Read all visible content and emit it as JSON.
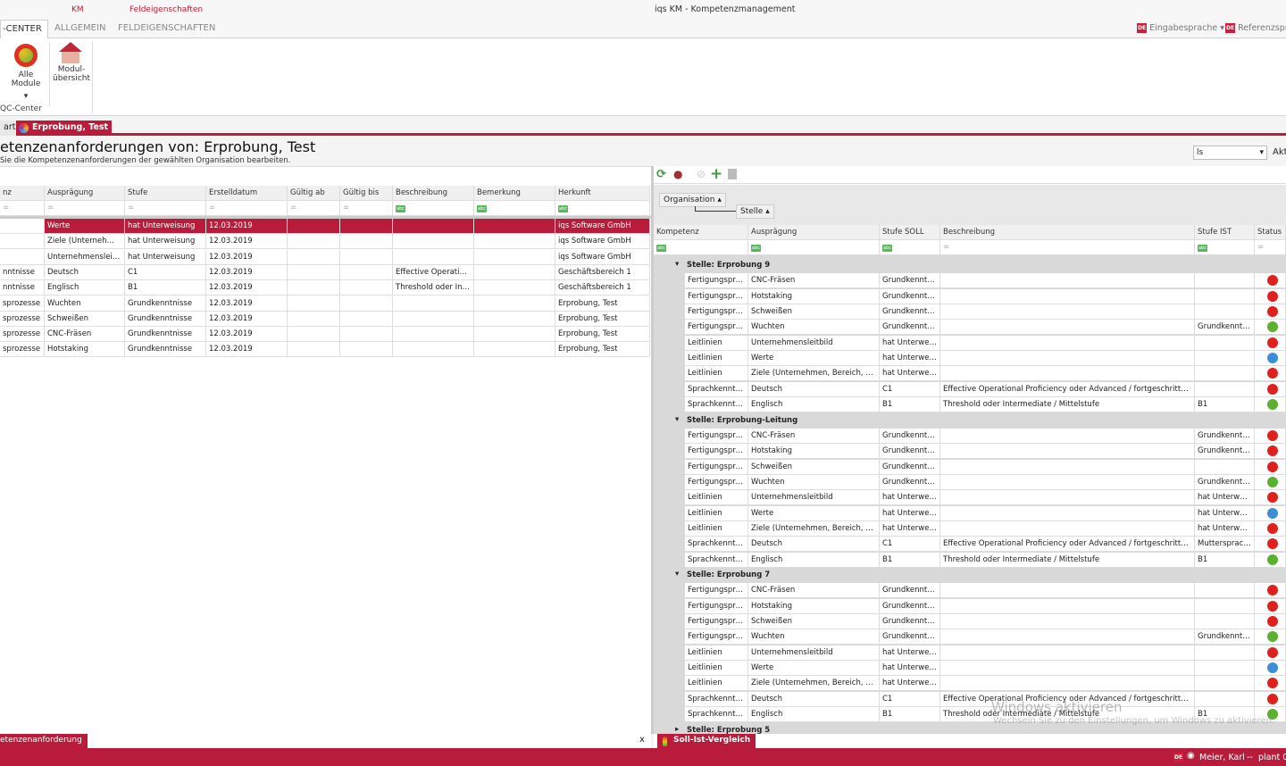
{
  "app": {
    "title": "iqs KM -  Kompetenzmanagement",
    "context_tabs": [
      "KM",
      "Feldeigenschaften"
    ]
  },
  "ribbon": {
    "tabs": [
      "-CENTER",
      "ALLGEMEIN",
      "FELDEIGENSCHAFTEN"
    ],
    "buttons": [
      "Alle Module",
      "Modul-übersicht"
    ],
    "group_label": "QC-Center",
    "lang_input": "Eingabesprache",
    "lang_ref": "Referenzspra",
    "lang_badge": "DE"
  },
  "doc_tabs": [
    "art",
    "Erprobung, Test"
  ],
  "page": {
    "title": "etenzenanforderungen von: Erprobung, Test",
    "subtitle": "Sie die Kompetenzenanforderungen der gewählten Organisation bearbeiten.",
    "combo_value": "ls",
    "combo_label": "Akt"
  },
  "left_table": {
    "columns": [
      "nz",
      "Ausprägung",
      "Stufe",
      "Erstelldatum",
      "Gültig ab",
      "Gültig bis",
      "Beschreibung",
      "Bemerkung",
      "Herkunft"
    ],
    "rows": [
      [
        "",
        "Werte",
        "hat Unterweisung",
        "12.03.2019",
        "",
        "",
        "",
        "",
        "iqs Software GmbH"
      ],
      [
        "",
        "Ziele (Unternehme...",
        "hat Unterweisung",
        "12.03.2019",
        "",
        "",
        "",
        "",
        "iqs Software GmbH"
      ],
      [
        "",
        "Unternehmensleitbild",
        "hat Unterweisung",
        "12.03.2019",
        "",
        "",
        "",
        "",
        "iqs Software GmbH"
      ],
      [
        "nntnisse",
        "Deutsch",
        "C1",
        "12.03.2019",
        "",
        "",
        "Effective Operatio...",
        "",
        "Geschäftsbereich 1"
      ],
      [
        "nntnisse",
        "Englisch",
        "B1",
        "12.03.2019",
        "",
        "",
        "Threshold oder Int...",
        "",
        "Geschäftsbereich 1"
      ],
      [
        "sprozesse",
        "Wuchten",
        "Grundkenntnisse",
        "12.03.2019",
        "",
        "",
        "",
        "",
        "Erprobung, Test"
      ],
      [
        "sprozesse",
        "Schweißen",
        "Grundkenntnisse",
        "12.03.2019",
        "",
        "",
        "",
        "",
        "Erprobung, Test"
      ],
      [
        "sprozesse",
        "CNC-Fräsen",
        "Grundkenntnisse",
        "12.03.2019",
        "",
        "",
        "",
        "",
        "Erprobung, Test"
      ],
      [
        "sprozesse",
        "Hotstaking",
        "Grundkenntnisse",
        "12.03.2019",
        "",
        "",
        "",
        "",
        "Erprobung, Test"
      ]
    ],
    "tab_label": "etenzenanforderung",
    "close": "x"
  },
  "right_table": {
    "group_by": [
      "Organisation",
      "Stelle"
    ],
    "columns": [
      "Kompetenz",
      "Ausprägung",
      "Stufe SOLL",
      "Beschreibung",
      "Stufe IST",
      "Status"
    ],
    "status_colors": {
      "red": "#e0201c",
      "green": "#5cb030",
      "blue": "#3a8fd8"
    },
    "groups": [
      {
        "label": "Stelle: Erprobung 9",
        "rows": [
          [
            "Fertigungspro...",
            "CNC-Fräsen",
            "Grundkenntni...",
            "",
            "",
            "red"
          ],
          [
            "Fertigungspro...",
            "Hotstaking",
            "Grundkenntni...",
            "",
            "",
            "red"
          ],
          [
            "Fertigungspro...",
            "Schweißen",
            "Grundkenntni...",
            "",
            "",
            "red"
          ],
          [
            "Fertigungspro...",
            "Wuchten",
            "Grundkenntni...",
            "",
            "Grundkenntni...",
            "green"
          ],
          [
            "Leitlinien",
            "Unternehmensleitbild",
            "hat Unterwei...",
            "",
            "",
            "red"
          ],
          [
            "Leitlinien",
            "Werte",
            "hat Unterwei...",
            "",
            "",
            "blue"
          ],
          [
            "Leitlinien",
            "Ziele (Unternehmen, Bereich, Abt...",
            "hat Unterwei...",
            "",
            "",
            "red"
          ],
          [
            "Sprachkenntni...",
            "Deutsch",
            "C1",
            "Effective Operational Proficiency oder Advanced  / fortgeschrittene ...",
            "",
            "red"
          ],
          [
            "Sprachkenntni...",
            "Englisch",
            "B1",
            "Threshold oder Intermediate / Mittelstufe",
            "B1",
            "green"
          ]
        ]
      },
      {
        "label": "Stelle: Erprobung-Leitung",
        "rows": [
          [
            "Fertigungspro...",
            "CNC-Fräsen",
            "Grundkenntni...",
            "",
            "Grundkenntni...",
            "red"
          ],
          [
            "Fertigungspro...",
            "Hotstaking",
            "Grundkenntni...",
            "",
            "Grundkenntni...",
            "red"
          ],
          [
            "Fertigungspro...",
            "Schweißen",
            "Grundkenntni...",
            "",
            "",
            "red"
          ],
          [
            "Fertigungspro...",
            "Wuchten",
            "Grundkenntni...",
            "",
            "Grundkenntni...",
            "green"
          ],
          [
            "Leitlinien",
            "Unternehmensleitbild",
            "hat Unterwei...",
            "",
            "hat Unterwei...",
            "red"
          ],
          [
            "Leitlinien",
            "Werte",
            "hat Unterwei...",
            "",
            "hat Unterwei...",
            "blue"
          ],
          [
            "Leitlinien",
            "Ziele (Unternehmen, Bereich, Abt...",
            "hat Unterwei...",
            "",
            "hat Unterwei...",
            "red"
          ],
          [
            "Sprachkenntni...",
            "Deutsch",
            "C1",
            "Effective Operational Proficiency oder Advanced  / fortgeschrittene ...",
            "Muttersprache",
            "red"
          ],
          [
            "Sprachkenntni...",
            "Englisch",
            "B1",
            "Threshold oder Intermediate / Mittelstufe",
            "B1",
            "green"
          ]
        ]
      },
      {
        "label": "Stelle: Erprobung 7",
        "rows": [
          [
            "Fertigungspro...",
            "CNC-Fräsen",
            "Grundkenntni...",
            "",
            "",
            "red"
          ],
          [
            "Fertigungspro...",
            "Hotstaking",
            "Grundkenntni...",
            "",
            "",
            "red"
          ],
          [
            "Fertigungspro...",
            "Schweißen",
            "Grundkenntni...",
            "",
            "",
            "red"
          ],
          [
            "Fertigungspro...",
            "Wuchten",
            "Grundkenntni...",
            "",
            "Grundkenntni...",
            "green"
          ],
          [
            "Leitlinien",
            "Unternehmensleitbild",
            "hat Unterwei...",
            "",
            "",
            "red"
          ],
          [
            "Leitlinien",
            "Werte",
            "hat Unterwei...",
            "",
            "",
            "blue"
          ],
          [
            "Leitlinien",
            "Ziele (Unternehmen, Bereich, Abt...",
            "hat Unterwei...",
            "",
            "",
            "red"
          ],
          [
            "Sprachkenntni...",
            "Deutsch",
            "C1",
            "Effective Operational Proficiency oder Advanced  / fortgeschrittene ...",
            "",
            "red"
          ],
          [
            "Sprachkenntni...",
            "Englisch",
            "B1",
            "Threshold oder Intermediate / Mittelstufe",
            "B1",
            "green"
          ]
        ]
      },
      {
        "label": "Stelle: Erprobung 5",
        "collapsed": true,
        "rows": []
      }
    ],
    "tab_label": "Soll-Ist-Vergleich"
  },
  "status_bar": {
    "user": "Meier, Karl",
    "separator": "--",
    "plant": "plant 0",
    "badge": "DE"
  },
  "watermark": {
    "title": "Windows aktivieren",
    "text": "Wechseln Sie zu den Einstellungen, um Windows zu aktivieren."
  }
}
